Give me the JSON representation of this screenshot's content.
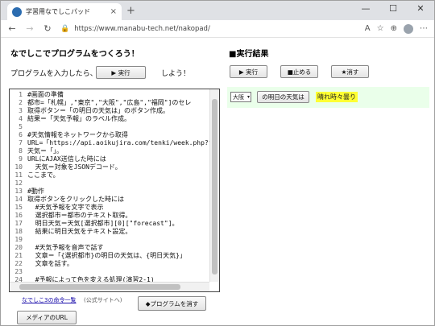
{
  "browser": {
    "tab_title": "学習用なでしこパッド",
    "tab_close": "×",
    "new_tab": "+",
    "url": "https://www.manabu-tech.net/nakopad/",
    "controls": {
      "minimize": "—",
      "maximize": "☐",
      "close": "✕"
    },
    "nav": {
      "back": "←",
      "forward": "→",
      "reload": "↻",
      "lock": "🔒"
    },
    "tools": {
      "read_aloud": "A",
      "favorite": "☆",
      "collections": "⊕",
      "more": "⋯"
    }
  },
  "page": {
    "title": "なでしこでプログラムをつくろう！",
    "prompt": "プログラムを入力したら、",
    "run_button": "▶ 実行",
    "prompt_suffix": "しよう！",
    "results_title": "■実行結果",
    "result_buttons": {
      "run": "▶ 実行",
      "stop": "■止める",
      "clear": "★消す"
    },
    "result": {
      "select_value": "大阪",
      "select_arrow": "▾",
      "button": "の明日の天気は",
      "weather": "晴れ時々曇り"
    },
    "editor_lines": [
      {
        "n": "1",
        "t": "#画面の準備"
      },
      {
        "n": "2",
        "t": "都市=「札幌」,\"東京\",\"大阪\",\"広島\",\"福岡\"]のセレ"
      },
      {
        "n": "3",
        "t": "取得ボタン＝「の明日の天気は」のボタン作成。"
      },
      {
        "n": "4",
        "t": "結果＝「天気予報」のラベル作成。"
      },
      {
        "n": "5",
        "t": ""
      },
      {
        "n": "6",
        "t": "#天気情報をネットワークから取得"
      },
      {
        "n": "7",
        "t": "URL=「https://api.aoikujira.com/tenki/week.php?f"
      },
      {
        "n": "8",
        "t": "天気＝「」。"
      },
      {
        "n": "9",
        "t": "URLにAJAX送信した時には"
      },
      {
        "n": "10",
        "t": "  天気＝対象をJSONデコード。"
      },
      {
        "n": "11",
        "t": "ここまで。"
      },
      {
        "n": "12",
        "t": ""
      },
      {
        "n": "13",
        "t": "#動作"
      },
      {
        "n": "14",
        "t": "取得ボタンをクリックした時には"
      },
      {
        "n": "15",
        "t": "  #天気予報を文字で表示"
      },
      {
        "n": "16",
        "t": "  選択都市＝都市のテキスト取得。"
      },
      {
        "n": "17",
        "t": "  明日天気＝天気[選択都市][0][\"forecast\"]。"
      },
      {
        "n": "18",
        "t": "  結果に明日天気をテキスト設定。"
      },
      {
        "n": "19",
        "t": ""
      },
      {
        "n": "20",
        "t": "  #天気予報を音声で話す"
      },
      {
        "n": "21",
        "t": "  文章＝「{選択都市}の明日の天気は、{明日天気}」"
      },
      {
        "n": "22",
        "t": "  文章を話す。"
      },
      {
        "n": "23",
        "t": ""
      },
      {
        "n": "24",
        "t": "  #予報によって色を変える処理(演習2-1)"
      }
    ],
    "command_link": "なでしこ3の命令一覧",
    "command_note": "(公式サイトへ)",
    "erase_button": "◆プログラムを消す",
    "media_button": "メディアのURL"
  }
}
